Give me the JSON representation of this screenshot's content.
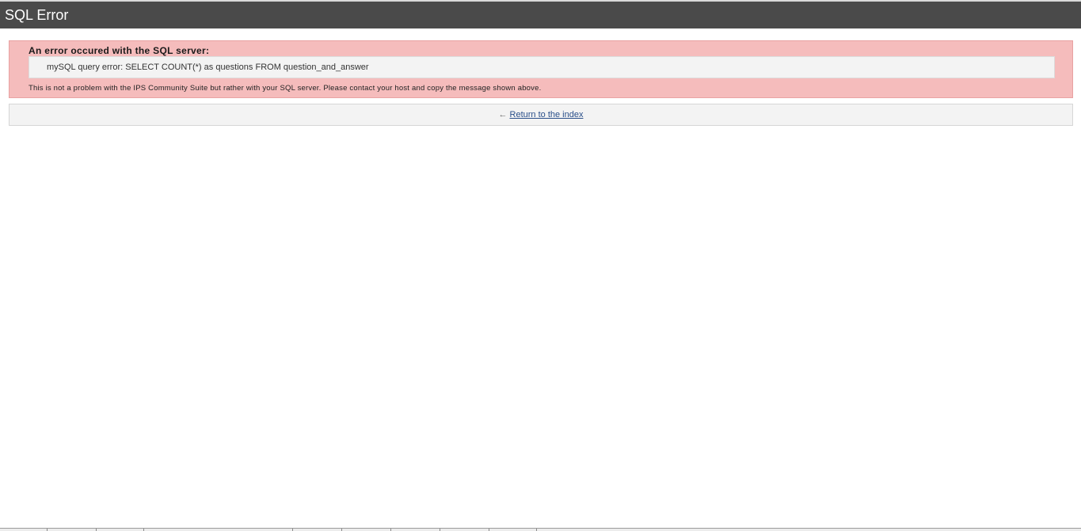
{
  "header": {
    "title": "SQL Error"
  },
  "error": {
    "heading": "An error occured with the SQL server:",
    "query_message": "mySQL query error: SELECT COUNT(*) as questions FROM question_and_answer",
    "note": "This is not a problem with the IPS Community Suite but rather with your SQL server. Please contact your host and copy the message shown above."
  },
  "nav": {
    "arrow": "←",
    "return_label": "Return to the index"
  },
  "colors": {
    "header_bg": "#4a4a4a",
    "error_bg": "#f5bcbc",
    "query_bg": "#f3f3f3",
    "link": "#2a4f8a"
  }
}
